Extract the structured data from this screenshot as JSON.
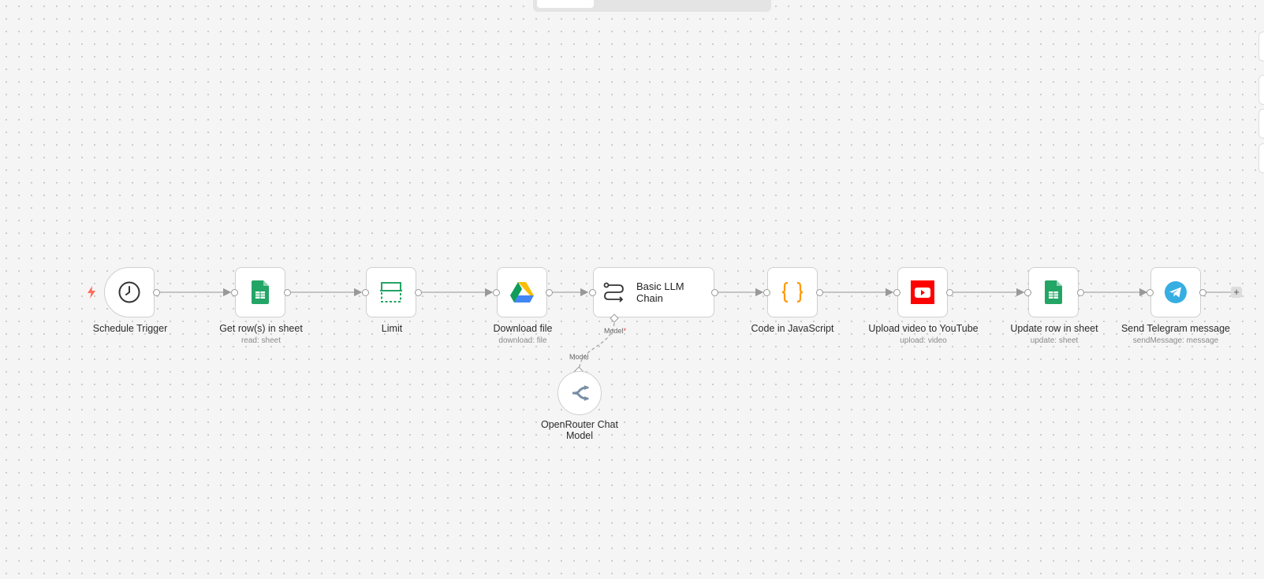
{
  "nodes": {
    "schedule": {
      "name": "Schedule Trigger"
    },
    "get_rows": {
      "name": "Get row(s) in sheet",
      "sub": "read: sheet"
    },
    "limit": {
      "name": "Limit"
    },
    "download": {
      "name": "Download file",
      "sub": "download: file"
    },
    "llm": {
      "name": "Basic LLM Chain",
      "port_label": "Model",
      "port_required": "*"
    },
    "code": {
      "name": "Code in JavaScript"
    },
    "youtube": {
      "name": "Upload video to YouTube",
      "sub": "upload: video"
    },
    "update_row": {
      "name": "Update row in sheet",
      "sub": "update: sheet"
    },
    "telegram": {
      "name": "Send Telegram message",
      "sub": "sendMessage: message"
    },
    "openrouter": {
      "name": "OpenRouter Chat Model",
      "port_label": "Model"
    }
  },
  "add_button_label": "+",
  "colors": {
    "sheets_green": "#23a566",
    "drive_yellow": "#fbbc04",
    "drive_blue": "#4285f4",
    "drive_green": "#0f9d58",
    "code_orange": "#ff9900",
    "youtube_red": "#ff0000",
    "telegram_blue": "#37aee2",
    "trigger_bolt": "#ff6d5a"
  },
  "icons": {
    "schedule": "clock-icon",
    "get_rows": "google-sheets-icon",
    "limit": "limit-icon",
    "download": "google-drive-icon",
    "llm": "llm-chain-icon",
    "code": "code-braces-icon",
    "youtube": "youtube-icon",
    "update_row": "google-sheets-icon",
    "telegram": "telegram-icon",
    "openrouter": "openrouter-icon"
  }
}
